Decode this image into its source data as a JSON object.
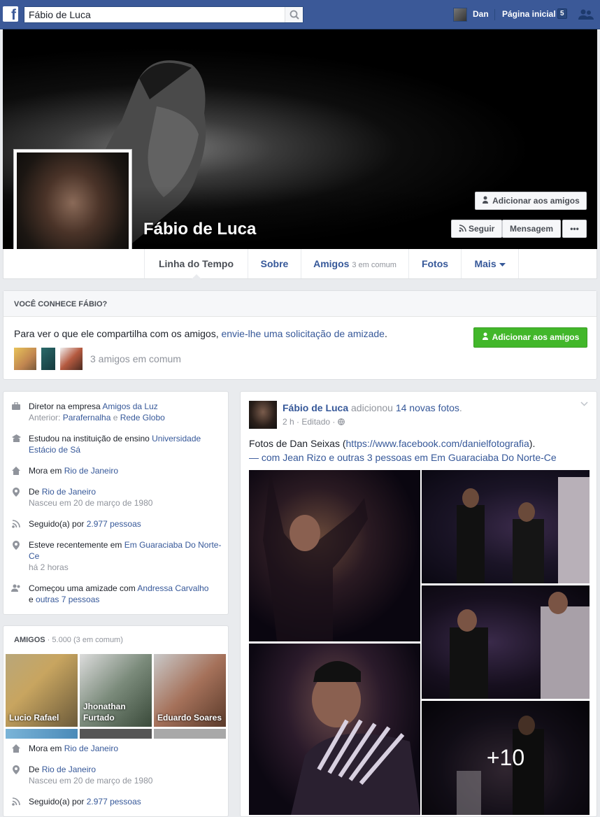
{
  "topbar": {
    "search_value": "Fábio de Luca",
    "user_name": "Dan",
    "home_label": "Página inicial",
    "home_badge": "5"
  },
  "profile": {
    "name": "Fábio de Luca",
    "add_friend": "Adicionar aos amigos",
    "follow": "Seguir",
    "message": "Mensagem",
    "more_dots": "•••"
  },
  "tabs": {
    "timeline": "Linha do Tempo",
    "about": "Sobre",
    "friends": "Amigos",
    "friends_sub": "3 em comum",
    "photos": "Fotos",
    "more": "Mais"
  },
  "know": {
    "header": "VOCÊ CONHECE FÁBIO?",
    "text_plain": "Para ver o que ele compartilha com os amigos, ",
    "text_link": "envie-lhe uma solicitação de amizade",
    "text_end": ".",
    "button": "Adicionar aos amigos",
    "mutual": "3 amigos em comum"
  },
  "intro": {
    "r1a": "Diretor na empresa ",
    "r1b": "Amigos da Luz",
    "r1c": "Anterior: ",
    "r1d": "Parafernalha",
    "r1e": " e ",
    "r1f": "Rede Globo",
    "r2a": "Estudou na instituição de ensino ",
    "r2b": "Universidade Estácio de Sá",
    "r3a": "Mora em ",
    "r3b": "Rio de Janeiro",
    "r4a": "De ",
    "r4b": "Rio de Janeiro",
    "r4c": "Nasceu em 20 de março de 1980",
    "r5a": "Seguido(a) por ",
    "r5b": "2.977 pessoas",
    "r6a": "Esteve recentemente em ",
    "r6b": "Em Guaraciaba Do Norte-Ce",
    "r6c": "há 2 horas",
    "r7a": "Começou uma amizade com ",
    "r7b": "Andressa Carvalho",
    "r7c": "e ",
    "r7d": "outras 7 pessoas"
  },
  "friends": {
    "title": "AMIGOS",
    "count": " · 5.000 (3 em comum)",
    "cards": [
      "Lucio Rafael",
      "Jhonathan Furtado",
      "Eduardo Soares"
    ],
    "f1a": "Mora em ",
    "f1b": "Rio de Janeiro",
    "f2a": "De ",
    "f2b": "Rio de Janeiro",
    "f2c": "Nasceu em 20 de março de 1980",
    "f3a": "Seguido(a) por ",
    "f3b": "2.977 pessoas"
  },
  "post": {
    "author": "Fábio de Luca",
    "action": " adicionou ",
    "photos_link": "14 novas fotos",
    "dot": ".",
    "time": "2 h",
    "edited": "Editado",
    "text1": "Fotos de Dan Seixas (",
    "url": "https://www.facebook.com/danielfotografia",
    "text2": ").",
    "with_pre": "— com ",
    "with1": "Jean Rizo",
    "with_mid": " e ",
    "with2": "outras 3 pessoas",
    "with_in": " em ",
    "place": "Em Guaraciaba Do Norte-Ce",
    "plus": "+10"
  },
  "colors": {
    "brand": "#3b5998",
    "link": "#365899",
    "green": "#42b72a"
  }
}
